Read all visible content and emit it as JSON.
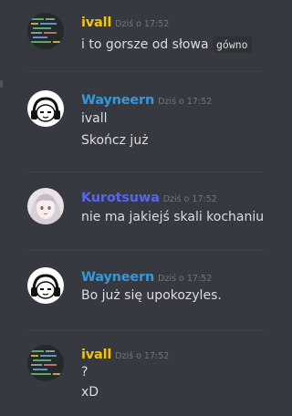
{
  "colors": {
    "background": "#36393f",
    "text": "#dcddde",
    "timestamp": "#72767d",
    "ivall": "#f1c40f",
    "wayneern": "#3498db",
    "kurotsuwa": "#5865f2",
    "code_bg": "#2f3136"
  },
  "messages": [
    {
      "author": "ivall",
      "timestamp": "Dziś o 17:52",
      "avatar": "code-screenshot-avatar",
      "lines": [
        "i to gorsze od słowa"
      ],
      "inline_code": "gówno"
    },
    {
      "author": "Wayneern",
      "timestamp": "Dziś o 17:52",
      "avatar": "headphones-character-avatar",
      "lines": [
        "ivall",
        "Skończ już"
      ]
    },
    {
      "author": "Kurotsuwa",
      "timestamp": "Dziś o 17:52",
      "avatar": "anime-girl-avatar",
      "lines": [
        "nie ma jakiejś skali kochaniutk"
      ]
    },
    {
      "author": "Wayneern",
      "timestamp": "Dziś o 17:52",
      "avatar": "headphones-character-avatar",
      "lines": [
        "Bo już się upokozyles."
      ]
    },
    {
      "author": "ivall",
      "timestamp": "Dziś o 17:52",
      "avatar": "code-screenshot-avatar",
      "lines": [
        "?",
        "xD"
      ]
    }
  ]
}
